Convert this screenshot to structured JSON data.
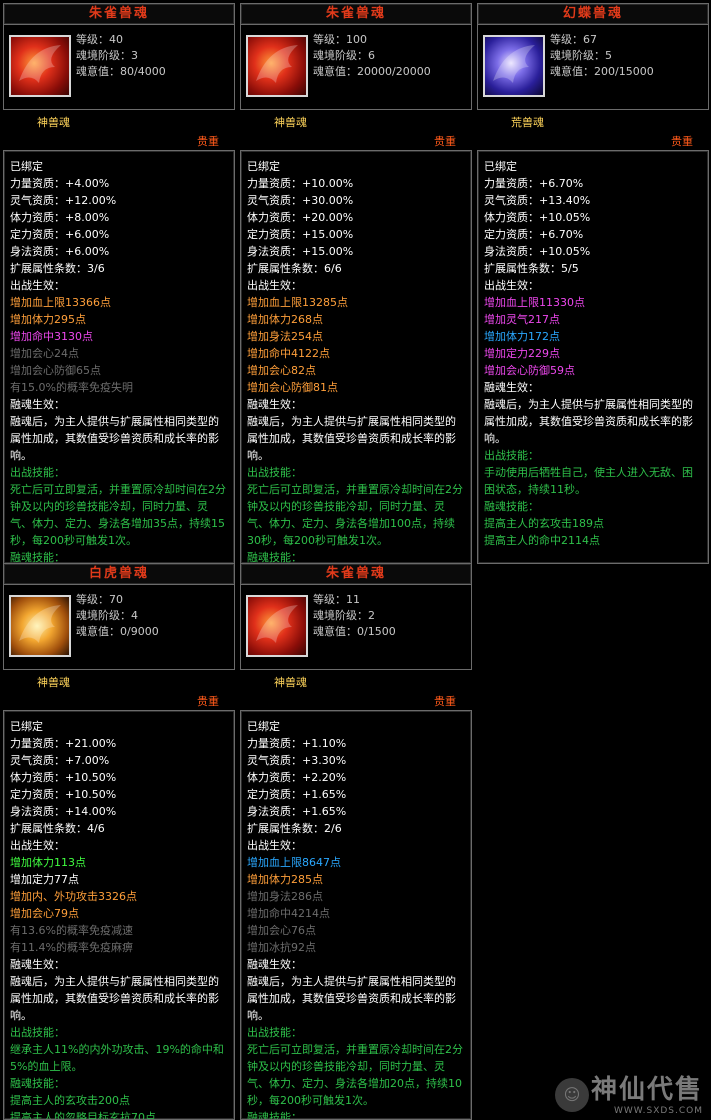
{
  "cards": [
    {
      "title": "朱雀兽魂",
      "icon": "phoenix-red-icon",
      "level": "等级：40",
      "tier": "魂境阶级：3",
      "intent": "魂意值：80/4000",
      "type": "神兽魂",
      "rarity": "贵重",
      "lines": [
        {
          "t": "已绑定",
          "c": "white"
        },
        {
          "t": "力量资质：+4.00%",
          "c": "white"
        },
        {
          "t": "灵气资质：+12.00%",
          "c": "white"
        },
        {
          "t": "体力资质：+8.00%",
          "c": "white"
        },
        {
          "t": "定力资质：+6.00%",
          "c": "white"
        },
        {
          "t": "身法资质：+6.00%",
          "c": "white"
        },
        {
          "t": "扩展属性条数：3/6",
          "c": "white"
        },
        {
          "t": "出战生效：",
          "c": "white"
        },
        {
          "t": "增加血上限13366点",
          "c": "orange"
        },
        {
          "t": "增加体力295点",
          "c": "orange"
        },
        {
          "t": "增加命中3130点",
          "c": "magenta"
        },
        {
          "t": "增加会心24点",
          "c": "gray"
        },
        {
          "t": "增加会心防御65点",
          "c": "gray"
        },
        {
          "t": "有15.0%的概率免疫失明",
          "c": "gray"
        },
        {
          "t": "融魂生效：",
          "c": "white"
        },
        {
          "t": "融魂后，为主人提供与扩展属性相同类型的属性加成，其数值受珍兽资质和成长率的影响。",
          "c": "white",
          "wrap": true
        },
        {
          "t": "出战技能：",
          "c": "green"
        },
        {
          "t": "死亡后可立即复活，并重置原冷却时间在2分钟及以内的珍兽技能冷却，同时力量、灵气、体力、定力、身法各增加35点，持续15秒，每200秒可触发1次。",
          "c": "green",
          "wrap": true
        },
        {
          "t": "融魂技能：",
          "c": "green"
        }
      ]
    },
    {
      "title": "朱雀兽魂",
      "icon": "phoenix-red-icon",
      "level": "等级：100",
      "tier": "魂境阶级：6",
      "intent": "魂意值：20000/20000",
      "type": "神兽魂",
      "rarity": "贵重",
      "lines": [
        {
          "t": "已绑定",
          "c": "white"
        },
        {
          "t": "力量资质：+10.00%",
          "c": "white"
        },
        {
          "t": "灵气资质：+30.00%",
          "c": "white"
        },
        {
          "t": "体力资质：+20.00%",
          "c": "white"
        },
        {
          "t": "定力资质：+15.00%",
          "c": "white"
        },
        {
          "t": "身法资质：+15.00%",
          "c": "white"
        },
        {
          "t": "扩展属性条数：6/6",
          "c": "white"
        },
        {
          "t": "出战生效：",
          "c": "white"
        },
        {
          "t": "增加血上限13285点",
          "c": "orange"
        },
        {
          "t": "增加体力268点",
          "c": "orange"
        },
        {
          "t": "增加身法254点",
          "c": "orange"
        },
        {
          "t": "增加命中4122点",
          "c": "orange"
        },
        {
          "t": "增加会心82点",
          "c": "orange"
        },
        {
          "t": "增加会心防御81点",
          "c": "orange"
        },
        {
          "t": "融魂生效：",
          "c": "white"
        },
        {
          "t": "融魂后，为主人提供与扩展属性相同类型的属性加成，其数值受珍兽资质和成长率的影响。",
          "c": "white",
          "wrap": true
        },
        {
          "t": "出战技能：",
          "c": "green"
        },
        {
          "t": "死亡后可立即复活，并重置原冷却时间在2分钟及以内的珍兽技能冷却，同时力量、灵气、体力、定力、身法各增加100点，持续30秒，每200秒可触发1次。",
          "c": "green",
          "wrap": true
        },
        {
          "t": "融魂技能：",
          "c": "green"
        }
      ]
    },
    {
      "title": "幻蝶兽魂",
      "icon": "butterfly-purple-icon",
      "level": "等级：67",
      "tier": "魂境阶级：5",
      "intent": "魂意值：200/15000",
      "type": "荒兽魂",
      "rarity": "贵重",
      "lines": [
        {
          "t": "已绑定",
          "c": "white"
        },
        {
          "t": "力量资质：+6.70%",
          "c": "white"
        },
        {
          "t": "灵气资质：+13.40%",
          "c": "white"
        },
        {
          "t": "体力资质：+10.05%",
          "c": "white"
        },
        {
          "t": "定力资质：+6.70%",
          "c": "white"
        },
        {
          "t": "身法资质：+10.05%",
          "c": "white"
        },
        {
          "t": "扩展属性条数：5/5",
          "c": "white"
        },
        {
          "t": "出战生效：",
          "c": "white"
        },
        {
          "t": "增加血上限11330点",
          "c": "magenta"
        },
        {
          "t": "增加灵气217点",
          "c": "magenta"
        },
        {
          "t": "增加体力172点",
          "c": "cyan"
        },
        {
          "t": "增加定力229点",
          "c": "magenta"
        },
        {
          "t": "增加会心防御59点",
          "c": "magenta"
        },
        {
          "t": "融魂生效：",
          "c": "white"
        },
        {
          "t": "融魂后，为主人提供与扩展属性相同类型的属性加成，其数值受珍兽资质和成长率的影响。",
          "c": "white",
          "wrap": true
        },
        {
          "t": "出战技能：",
          "c": "green"
        },
        {
          "t": "手动使用后牺牲自己，使主人进入无敌、困困状态，持续11秒。",
          "c": "green",
          "wrap": true
        },
        {
          "t": "融魂技能：",
          "c": "green"
        },
        {
          "t": "提高主人的玄攻击189点",
          "c": "green"
        },
        {
          "t": "提高主人的命中2114点",
          "c": "green"
        }
      ]
    },
    {
      "title": "白虎兽魂",
      "icon": "tiger-gold-icon",
      "level": "等级：70",
      "tier": "魂境阶级：4",
      "intent": "魂意值：0/9000",
      "type": "神兽魂",
      "rarity": "贵重",
      "lines": [
        {
          "t": "已绑定",
          "c": "white"
        },
        {
          "t": "力量资质：+21.00%",
          "c": "white"
        },
        {
          "t": "灵气资质：+7.00%",
          "c": "white"
        },
        {
          "t": "体力资质：+10.50%",
          "c": "white"
        },
        {
          "t": "定力资质：+10.50%",
          "c": "white"
        },
        {
          "t": "身法资质：+14.00%",
          "c": "white"
        },
        {
          "t": "扩展属性条数：4/6",
          "c": "white"
        },
        {
          "t": "出战生效：",
          "c": "white"
        },
        {
          "t": "增加体力113点",
          "c": "lime"
        },
        {
          "t": "增加定力77点",
          "c": "white"
        },
        {
          "t": "增加内、外功攻击3326点",
          "c": "orange"
        },
        {
          "t": "增加会心79点",
          "c": "orange"
        },
        {
          "t": "有13.6%的概率免疫减速",
          "c": "gray"
        },
        {
          "t": "有11.4%的概率免疫麻痹",
          "c": "gray"
        },
        {
          "t": "融魂生效：",
          "c": "white"
        },
        {
          "t": "融魂后，为主人提供与扩展属性相同类型的属性加成，其数值受珍兽资质和成长率的影响。",
          "c": "white",
          "wrap": true
        },
        {
          "t": "出战技能：",
          "c": "green"
        },
        {
          "t": "继承主人11%的内外功攻击、19%的命中和5%的血上限。",
          "c": "green",
          "wrap": true
        },
        {
          "t": "融魂技能：",
          "c": "green"
        },
        {
          "t": "提高主人的玄攻击200点",
          "c": "green"
        },
        {
          "t": "提高主人的忽略目标玄抗70点",
          "c": "green"
        }
      ]
    },
    {
      "title": "朱雀兽魂",
      "icon": "phoenix-red-icon",
      "level": "等级：11",
      "tier": "魂境阶级：2",
      "intent": "魂意值：0/1500",
      "type": "神兽魂",
      "rarity": "贵重",
      "lines": [
        {
          "t": "已绑定",
          "c": "white"
        },
        {
          "t": "力量资质：+1.10%",
          "c": "white"
        },
        {
          "t": "灵气资质：+3.30%",
          "c": "white"
        },
        {
          "t": "体力资质：+2.20%",
          "c": "white"
        },
        {
          "t": "定力资质：+1.65%",
          "c": "white"
        },
        {
          "t": "身法资质：+1.65%",
          "c": "white"
        },
        {
          "t": "扩展属性条数：2/6",
          "c": "white"
        },
        {
          "t": "出战生效：",
          "c": "white"
        },
        {
          "t": "增加血上限8647点",
          "c": "cyan"
        },
        {
          "t": "增加体力285点",
          "c": "orange"
        },
        {
          "t": "增加身法286点",
          "c": "gray"
        },
        {
          "t": "增加命中4214点",
          "c": "gray"
        },
        {
          "t": "增加会心76点",
          "c": "gray"
        },
        {
          "t": "增加冰抗92点",
          "c": "gray"
        },
        {
          "t": "融魂生效：",
          "c": "white"
        },
        {
          "t": "融魂后，为主人提供与扩展属性相同类型的属性加成，其数值受珍兽资质和成长率的影响。",
          "c": "white",
          "wrap": true
        },
        {
          "t": "出战技能：",
          "c": "green"
        },
        {
          "t": "死亡后可立即复活，并重置原冷却时间在2分钟及以内的珍兽技能冷却，同时力量、灵气、体力、定力、身法各增加20点，持续10秒，每200秒可触发1次。",
          "c": "green",
          "wrap": true
        },
        {
          "t": "融魂技能：",
          "c": "green"
        }
      ]
    }
  ],
  "watermark": {
    "brand": "神仙代售",
    "url": "WWW.SXDS.COM",
    "icon": "mascot-logo-icon"
  }
}
